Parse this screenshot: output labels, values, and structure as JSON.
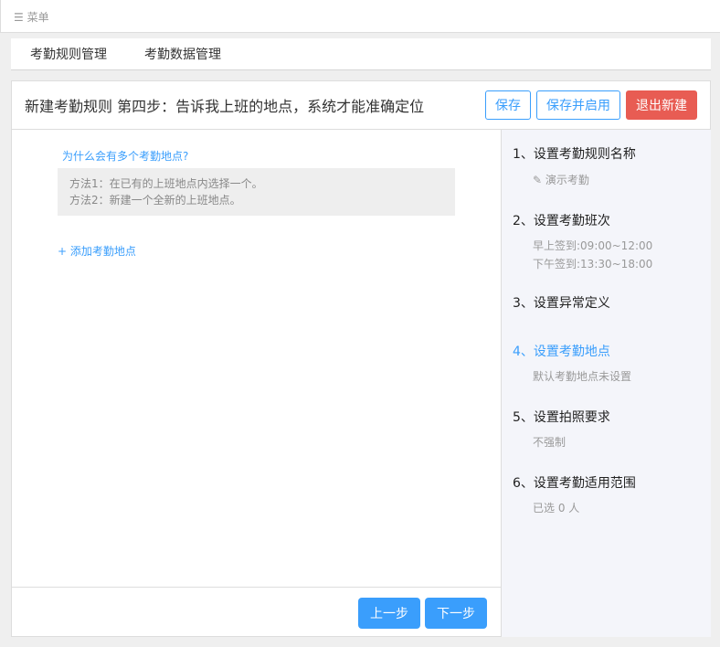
{
  "menu": {
    "icon": "menu-icon",
    "label": "菜单"
  },
  "tabs": [
    "考勤规则管理",
    "考勤数据管理"
  ],
  "header": {
    "title": "新建考勤规则 第四步：告诉我上班的地点，系统才能准确定位",
    "save": "保存",
    "save_enable": "保存并启用",
    "exit": "退出新建"
  },
  "main": {
    "why": "为什么会有多个考勤地点?",
    "tips": [
      "方法1：在已有的上班地点内选择一个。",
      "方法2：新建一个全新的上班地点。"
    ],
    "add": "+ 添加考勤地点",
    "prev": "上一步",
    "next": "下一步"
  },
  "steps": [
    {
      "title": "1、设置考勤规则名称",
      "desc": [
        "演示考勤"
      ]
    },
    {
      "title": "2、设置考勤班次",
      "desc": [
        "早上签到:09:00~12:00",
        "下午签到:13:30~18:00"
      ]
    },
    {
      "title": "3、设置异常定义",
      "desc": []
    },
    {
      "title": "4、设置考勤地点",
      "desc": [
        "默认考勤地点未设置"
      ]
    },
    {
      "title": "5、设置拍照要求",
      "desc": [
        "不强制"
      ]
    },
    {
      "title": "6、设置考勤适用范围",
      "desc": [
        "已选 0 人"
      ]
    }
  ],
  "colors": {
    "accent": "#3a9efc",
    "danger": "#e85c53"
  }
}
